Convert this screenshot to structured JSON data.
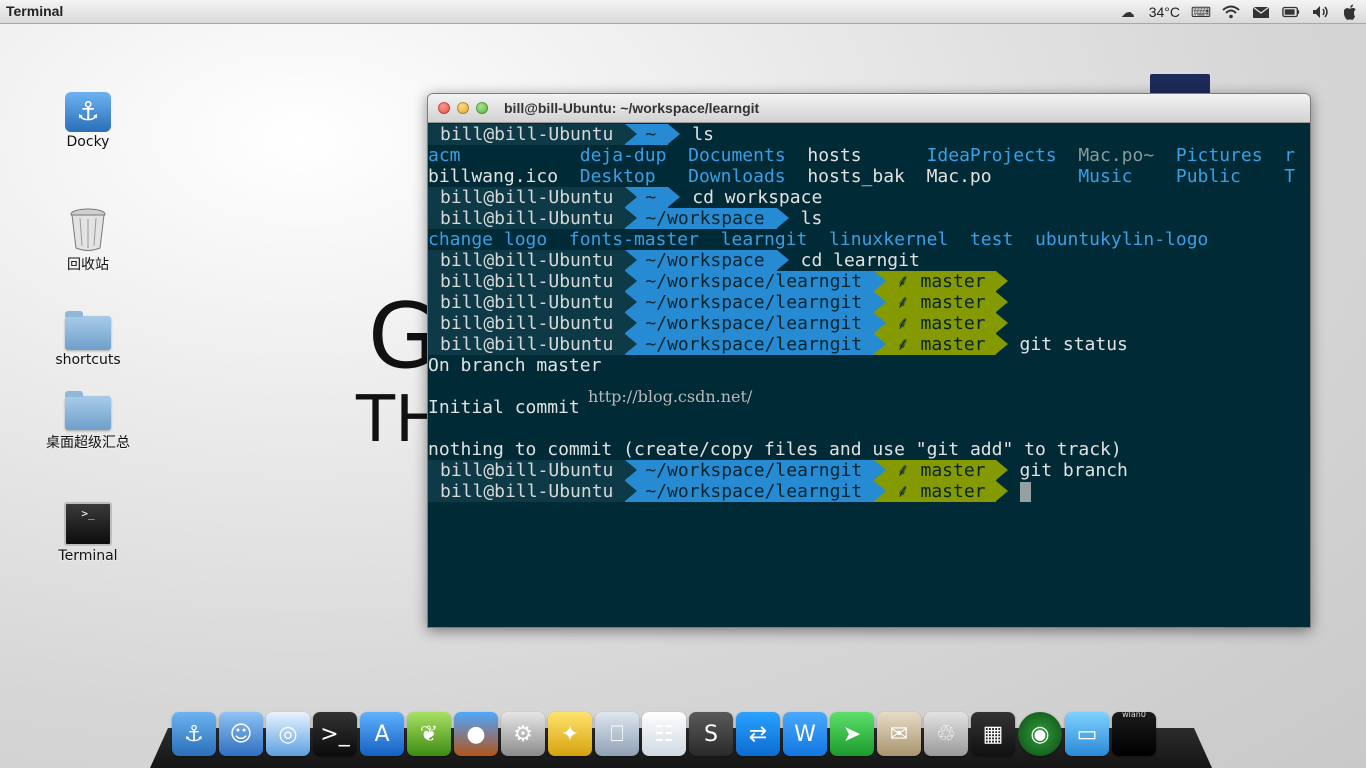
{
  "topbar": {
    "app_name": "Terminal",
    "temperature": "34°C",
    "tray_icons": [
      "weather-icon",
      "keyboard-icon",
      "wifi-icon",
      "mail-icon",
      "battery-icon",
      "volume-icon",
      "apple-icon"
    ]
  },
  "desktop": {
    "icons": [
      {
        "label": "Docky",
        "icon": "anchor-icon"
      },
      {
        "label": "回收站",
        "icon": "trash-icon"
      },
      {
        "label": "shortcuts",
        "icon": "folder-icon"
      },
      {
        "label": "桌面超级汇总",
        "icon": "folder-icon"
      },
      {
        "label": "Terminal",
        "icon": "terminal-icon"
      }
    ],
    "bg_text_1": "G",
    "bg_text_2": "TH"
  },
  "terminal": {
    "title": "bill@bill-Ubuntu: ~/workspace/learngit",
    "user": "bill@bill-Ubuntu",
    "branch": "master",
    "lines": [
      {
        "dir": "~",
        "cmd": "ls"
      },
      {
        "out": "acm           deja-dup  Documents  hosts      IdeaProjects  Mac.po~  Pictures  r"
      },
      {
        "out": "billwang.ico  Desktop   Downloads  hosts_bak  Mac.po        Music    Public    T"
      },
      {
        "dir": "~",
        "cmd": "cd workspace"
      },
      {
        "dir": "~/workspace",
        "cmd": "ls"
      },
      {
        "out": "change logo  fonts-master  learngit  linuxkernel  test  ubuntukylin-logo"
      },
      {
        "dir": "~/workspace",
        "cmd": "cd learngit"
      },
      {
        "dir": "~/workspace/learngit",
        "git": true,
        "cmd": ""
      },
      {
        "dir": "~/workspace/learngit",
        "git": true,
        "cmd": ""
      },
      {
        "dir": "~/workspace/learngit",
        "git": true,
        "cmd": ""
      },
      {
        "dir": "~/workspace/learngit",
        "git": true,
        "cmd": "git status"
      },
      {
        "out": "On branch master"
      },
      {
        "out": ""
      },
      {
        "out": "Initial commit"
      },
      {
        "out": ""
      },
      {
        "out": "nothing to commit (create/copy files and use \"git add\" to track)"
      },
      {
        "dir": "~/workspace/learngit",
        "git": true,
        "cmd": "git branch"
      },
      {
        "dir": "~/workspace/learngit",
        "git": true,
        "cmd": "",
        "cursor": true
      }
    ],
    "watermark": "http://blog.csdn.net/"
  },
  "dock": {
    "items": [
      "anchor-icon",
      "finder-icon",
      "safari-icon",
      "terminal-icon",
      "app-store-icon",
      "leaf-icon",
      "globe-icon",
      "settings-icon",
      "puzzle-icon",
      "computer-icon",
      "document-icon",
      "sublime-icon",
      "teamviewer-icon",
      "wps-icon",
      "paper-plane-icon",
      "package-icon",
      "trash-icon",
      "workspace-icon",
      "radar-icon",
      "window-icon",
      "network-icon"
    ],
    "network_label": "wlan0"
  }
}
